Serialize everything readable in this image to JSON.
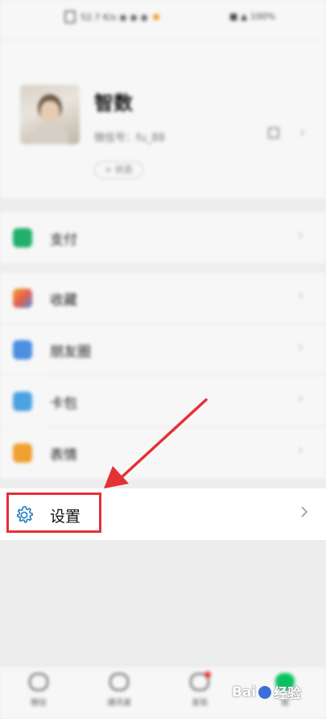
{
  "status_bar": {
    "left_text": "52.7 K/s ◉ ◉ ◉",
    "right_text": "■ ▲ 100%"
  },
  "profile": {
    "name": "智数",
    "wechat_id": "微信号：fu_88",
    "status_label": "+ 状态"
  },
  "menu": [
    {
      "label": "支付",
      "icon": "pay-icon",
      "color": "#20b06a"
    },
    {
      "label": "收藏",
      "icon": "favorites-icon",
      "color": "#f0a030"
    },
    {
      "label": "朋友圈",
      "icon": "moments-icon",
      "color": "#4a8fe0"
    },
    {
      "label": "卡包",
      "icon": "cards-icon",
      "color": "#4aa3e0"
    },
    {
      "label": "表情",
      "icon": "stickers-icon",
      "color": "#f0a030"
    }
  ],
  "settings": {
    "label": "设置",
    "icon": "gear-icon",
    "accent": "#1f7fc4",
    "highlight_color": "#e53036"
  },
  "bottom_nav": [
    {
      "label": "微信",
      "icon": "chat-icon"
    },
    {
      "label": "通讯录",
      "icon": "contacts-icon"
    },
    {
      "label": "发现",
      "icon": "discover-icon"
    },
    {
      "label": "我",
      "icon": "me-icon"
    }
  ],
  "watermark": {
    "text_left": "Bai",
    "text_right": "经验"
  }
}
